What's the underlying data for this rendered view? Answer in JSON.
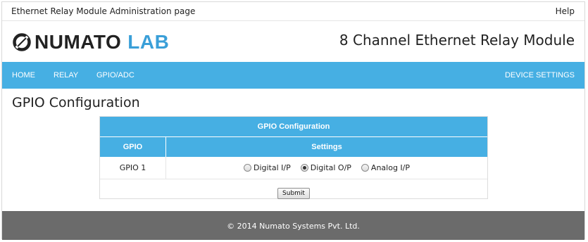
{
  "topbar": {
    "site_title": "Ethernet Relay Module Administration page",
    "help_label": "Help"
  },
  "brand": {
    "logo_word_1": "NUMATO",
    "logo_word_2": "LAB",
    "product_title": "8 Channel Ethernet Relay Module",
    "accent_color": "#3a9fd8"
  },
  "nav": {
    "items": [
      {
        "label": "HOME"
      },
      {
        "label": "RELAY"
      },
      {
        "label": "GPIO/ADC"
      }
    ],
    "right_item": {
      "label": "DEVICE SETTINGS"
    },
    "bar_color": "#46afe3"
  },
  "page": {
    "heading": "GPIO Configuration"
  },
  "config_table": {
    "title": "GPIO Configuration",
    "columns": [
      "GPIO",
      "Settings"
    ],
    "rows": [
      {
        "gpio": "GPIO 1",
        "options": [
          {
            "label": "Digital I/P",
            "checked": false
          },
          {
            "label": "Digital O/P",
            "checked": true
          },
          {
            "label": "Analog I/P",
            "checked": false
          }
        ]
      }
    ],
    "submit_label": "Submit"
  },
  "footer": {
    "copyright": "© 2014 Numato Systems Pvt. Ltd.",
    "bar_color": "#6b6b6b"
  }
}
